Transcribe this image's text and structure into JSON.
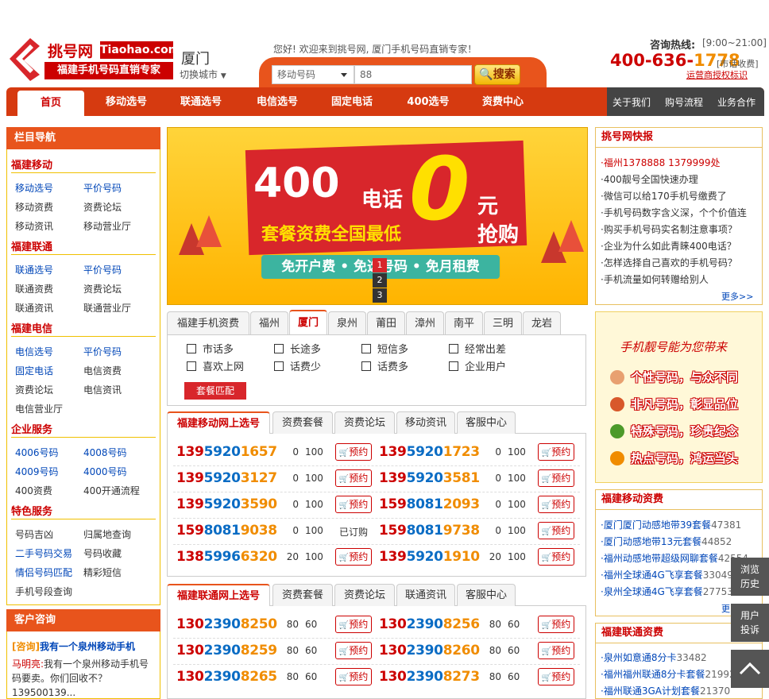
{
  "header": {
    "logo_cn": "挑号网",
    "logo_en": "Tiaohao.com",
    "logo_sub": "福建手机号码直销专家",
    "city": "厦门",
    "city_switch": "切换城市",
    "welcome": "您好! 欢迎来到挑号网, 厦门手机号码直销专家！",
    "search_type": "移动号码",
    "search_value": "88",
    "search_button": "搜索",
    "hotline_label": "咨询热线:",
    "hotline_hours": "[9:00~21:00]",
    "hotline_number_a": "400-636-",
    "hotline_number_b": "1778",
    "hotline_fee": "[市话收费]",
    "auth_text": "运营商授权标识"
  },
  "nav": {
    "items": [
      "首页",
      "移动选号",
      "联通选号",
      "电信选号",
      "固定电话",
      "400选号",
      "资费中心"
    ],
    "right": [
      "关于我们",
      "购号流程",
      "业务合作"
    ]
  },
  "sidebar": {
    "title": "栏目导航",
    "sections": [
      {
        "name": "福建移动",
        "links": [
          "移动选号",
          "平价号码",
          "移动资费",
          "资费论坛",
          "移动资讯",
          "移动营业厅"
        ]
      },
      {
        "name": "福建联通",
        "links": [
          "联通选号",
          "平价号码",
          "联通资费",
          "资费论坛",
          "联通资讯",
          "联通营业厅"
        ]
      },
      {
        "name": "福建电信",
        "links": [
          "电信选号",
          "平价号码",
          "固定电话",
          "电信资费",
          "资费论坛",
          "电信资讯",
          "电信营业厅"
        ]
      },
      {
        "name": "企业服务",
        "links": [
          "4006号码",
          "4008号码",
          "4009号码",
          "4000号码",
          "400资费",
          "400开通流程"
        ]
      },
      {
        "name": "特色服务",
        "links": [
          "号码吉凶",
          "归属地查询",
          "二手号码交易",
          "号码收藏",
          "情侣号码匹配",
          "精彩短信",
          "手机号段查询"
        ]
      }
    ]
  },
  "consult": {
    "title": "客户咨询",
    "tag": "[咨询]",
    "question": "我有一个泉州移动手机",
    "who": "马明亮:",
    "answer": "我有一个泉州移动手机号码要卖。你们回收不？",
    "more": "139500139..."
  },
  "banner": {
    "big": "400",
    "dh": "电话",
    "zero": "0",
    "yuan": "元",
    "qg": "抢购",
    "tc": "套餐资费全国最低",
    "ribbon": "免开户费 • 免选号码 • 免月租费",
    "dots": [
      "1",
      "2",
      "3"
    ]
  },
  "city_tabs": [
    "福建手机资费",
    "福州",
    "厦门",
    "泉州",
    "莆田",
    "漳州",
    "南平",
    "三明",
    "龙岩"
  ],
  "filters": [
    "市话多",
    "长途多",
    "短信多",
    "经常出差",
    "喜欢上网",
    "话费少",
    "话费多",
    "企业用户"
  ],
  "match_button": "套餐匹配",
  "mobile_panel": {
    "tabs": [
      "福建移动网上选号",
      "资费套餐",
      "资费论坛",
      "移动资讯",
      "客服中心"
    ],
    "rows": [
      [
        {
          "a": "139",
          "b": "5920",
          "c": "1657",
          "p1": "0",
          "p2": "100",
          "s": "预约"
        },
        {
          "a": "139",
          "b": "5920",
          "c": "1723",
          "p1": "0",
          "p2": "100",
          "s": "预约"
        }
      ],
      [
        {
          "a": "139",
          "b": "5920",
          "c": "3127",
          "p1": "0",
          "p2": "100",
          "s": "预约"
        },
        {
          "a": "139",
          "b": "5920",
          "c": "3581",
          "p1": "0",
          "p2": "100",
          "s": "预约"
        }
      ],
      [
        {
          "a": "139",
          "b": "5920",
          "c": "3590",
          "p1": "0",
          "p2": "100",
          "s": "预约"
        },
        {
          "a": "159",
          "b": "8081",
          "c": "2093",
          "p1": "0",
          "p2": "100",
          "s": "预约"
        }
      ],
      [
        {
          "a": "159",
          "b": "8081",
          "c": "9038",
          "p1": "0",
          "p2": "100",
          "s": "已订购"
        },
        {
          "a": "159",
          "b": "8081",
          "c": "9738",
          "p1": "0",
          "p2": "100",
          "s": "预约"
        }
      ],
      [
        {
          "a": "138",
          "b": "5996",
          "c": "6320",
          "p1": "20",
          "p2": "100",
          "s": "预约"
        },
        {
          "a": "139",
          "b": "5920",
          "c": "1910",
          "p1": "20",
          "p2": "100",
          "s": "预约"
        }
      ]
    ]
  },
  "unicom_panel": {
    "tabs": [
      "福建联通网上选号",
      "资费套餐",
      "资费论坛",
      "联通资讯",
      "客服中心"
    ],
    "rows": [
      [
        {
          "a": "130",
          "b": "2390",
          "c": "8250",
          "p1": "80",
          "p2": "60",
          "s": "预约"
        },
        {
          "a": "130",
          "b": "2390",
          "c": "8256",
          "p1": "80",
          "p2": "60",
          "s": "预约"
        }
      ],
      [
        {
          "a": "130",
          "b": "2390",
          "c": "8259",
          "p1": "80",
          "p2": "60",
          "s": "预约"
        },
        {
          "a": "130",
          "b": "2390",
          "c": "8260",
          "p1": "80",
          "p2": "60",
          "s": "预约"
        }
      ],
      [
        {
          "a": "130",
          "b": "2390",
          "c": "8265",
          "p1": "80",
          "p2": "60",
          "s": "预约"
        },
        {
          "a": "130",
          "b": "2390",
          "c": "8273",
          "p1": "80",
          "p2": "60",
          "s": "预约"
        }
      ]
    ]
  },
  "news": {
    "title": "挑号网快报",
    "items": [
      "福州1378888 1379999处",
      "400靓号全国快速办理",
      "微信可以给170手机号缴费了",
      "手机号码数字含义深，个个价值连",
      "购买手机号码实名制注意事项？",
      "企业为什么如此青睐400电话？",
      "怎样选择自己喜欢的手机号码？",
      "手机流量如何转赠给别人"
    ],
    "more": "更多>>"
  },
  "ad": {
    "title": "手机靓号能为您带来",
    "items": [
      "个性号码，与众不同",
      "非凡号码，彰显品位",
      "特殊号码，珍贵纪念",
      "热点号码，鸿运当头"
    ]
  },
  "mobile_fees": {
    "title": "福建移动资费",
    "items": [
      {
        "t": "厦门厦门动感地带39套餐",
        "n": "47381"
      },
      {
        "t": "厦门动感地带13元套餐",
        "n": "44852"
      },
      {
        "t": "福州动感地带超级网聊套餐",
        "n": "42554"
      },
      {
        "t": "福州全球通4G飞享套餐",
        "n": "33049"
      },
      {
        "t": "泉州全球通4G飞享套餐",
        "n": "27753"
      }
    ],
    "more": "更多"
  },
  "unicom_fees": {
    "title": "福建联通资费",
    "items": [
      {
        "t": "泉州如意通8分卡",
        "n": "33482"
      },
      {
        "t": "福州福州联通8分卡套餐",
        "n": "21992"
      },
      {
        "t": "福州联通3GA计划套餐",
        "n": "21370"
      }
    ]
  },
  "float": {
    "history": "浏览历史",
    "complaint": "用户投诉"
  }
}
